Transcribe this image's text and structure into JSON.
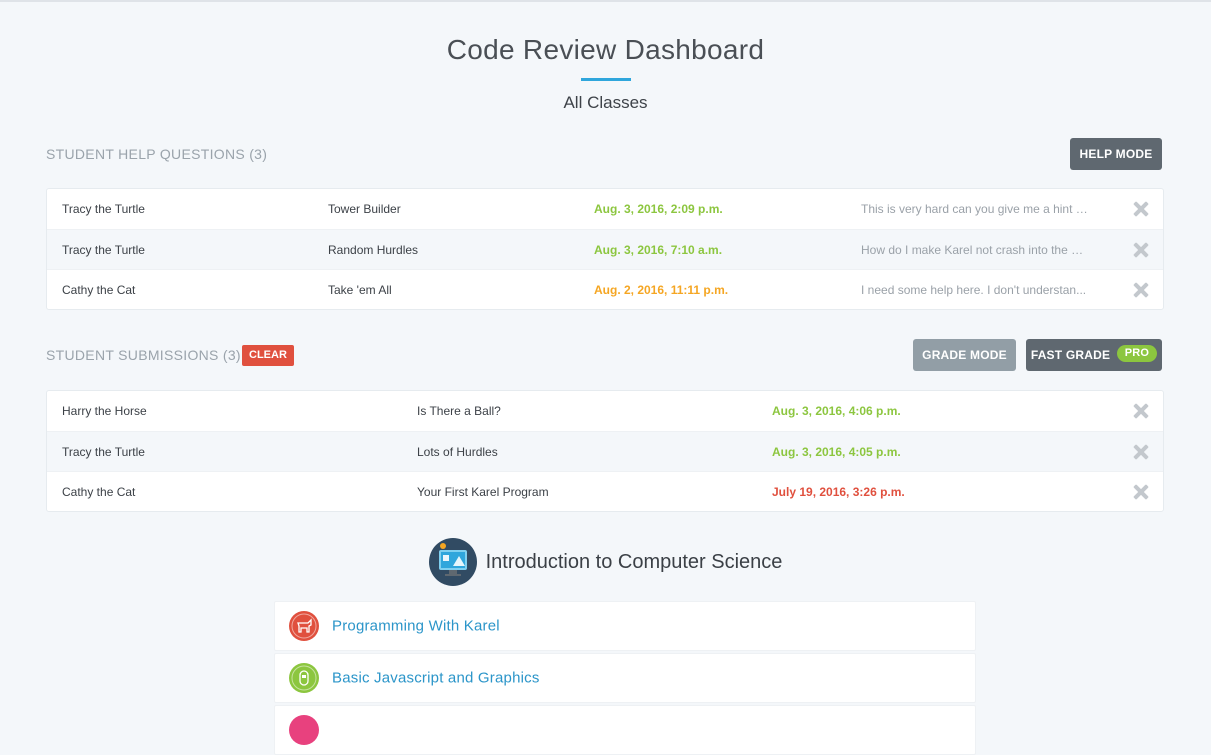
{
  "header": {
    "title": "Code Review Dashboard",
    "subtitle": "All Classes"
  },
  "help_section": {
    "title": "STUDENT HELP QUESTIONS (3)",
    "mode_button": "HELP MODE",
    "rows": [
      {
        "student": "Tracy the Turtle",
        "assignment": "Tower Builder",
        "date": "Aug. 3, 2016, 2:09 p.m.",
        "date_color": "#8cc63f",
        "message": "This is very hard can you give me a hint o..."
      },
      {
        "student": "Tracy the Turtle",
        "assignment": "Random Hurdles",
        "date": "Aug. 3, 2016, 7:10 a.m.",
        "date_color": "#8cc63f",
        "message": "How do I make Karel not crash into the w..."
      },
      {
        "student": "Cathy the Cat",
        "assignment": "Take 'em All",
        "date": "Aug. 2, 2016, 11:11 p.m.",
        "date_color": "#f5a623",
        "message": "I need some help here. I don't understan..."
      }
    ]
  },
  "submissions_section": {
    "title": "STUDENT SUBMISSIONS (3)",
    "clear_label": "CLEAR",
    "grade_mode_button": "GRADE MODE",
    "fast_grade_button": "FAST GRADE",
    "pro_badge": "PRO",
    "rows": [
      {
        "student": "Harry the Horse",
        "assignment": "Is There a Ball?",
        "date": "Aug. 3, 2016, 4:06 p.m.",
        "date_color": "#8cc63f"
      },
      {
        "student": "Tracy the Turtle",
        "assignment": "Lots of Hurdles",
        "date": "Aug. 3, 2016, 4:05 p.m.",
        "date_color": "#8cc63f"
      },
      {
        "student": "Cathy the Cat",
        "assignment": "Your First Karel Program",
        "date": "July 19, 2016, 3:26 p.m.",
        "date_color": "#e0503e"
      }
    ]
  },
  "course": {
    "title": "Introduction to Computer Science",
    "icon": "computer-monitor-icon",
    "modules": [
      {
        "label": "Programming With Karel",
        "icon": "karel-dog-icon",
        "color": "#e0503e"
      },
      {
        "label": "Basic Javascript and Graphics",
        "icon": "robot-icon",
        "color": "#8cc63f"
      },
      {
        "label": "",
        "icon": "module-icon",
        "color": "#e8417e"
      }
    ]
  }
}
